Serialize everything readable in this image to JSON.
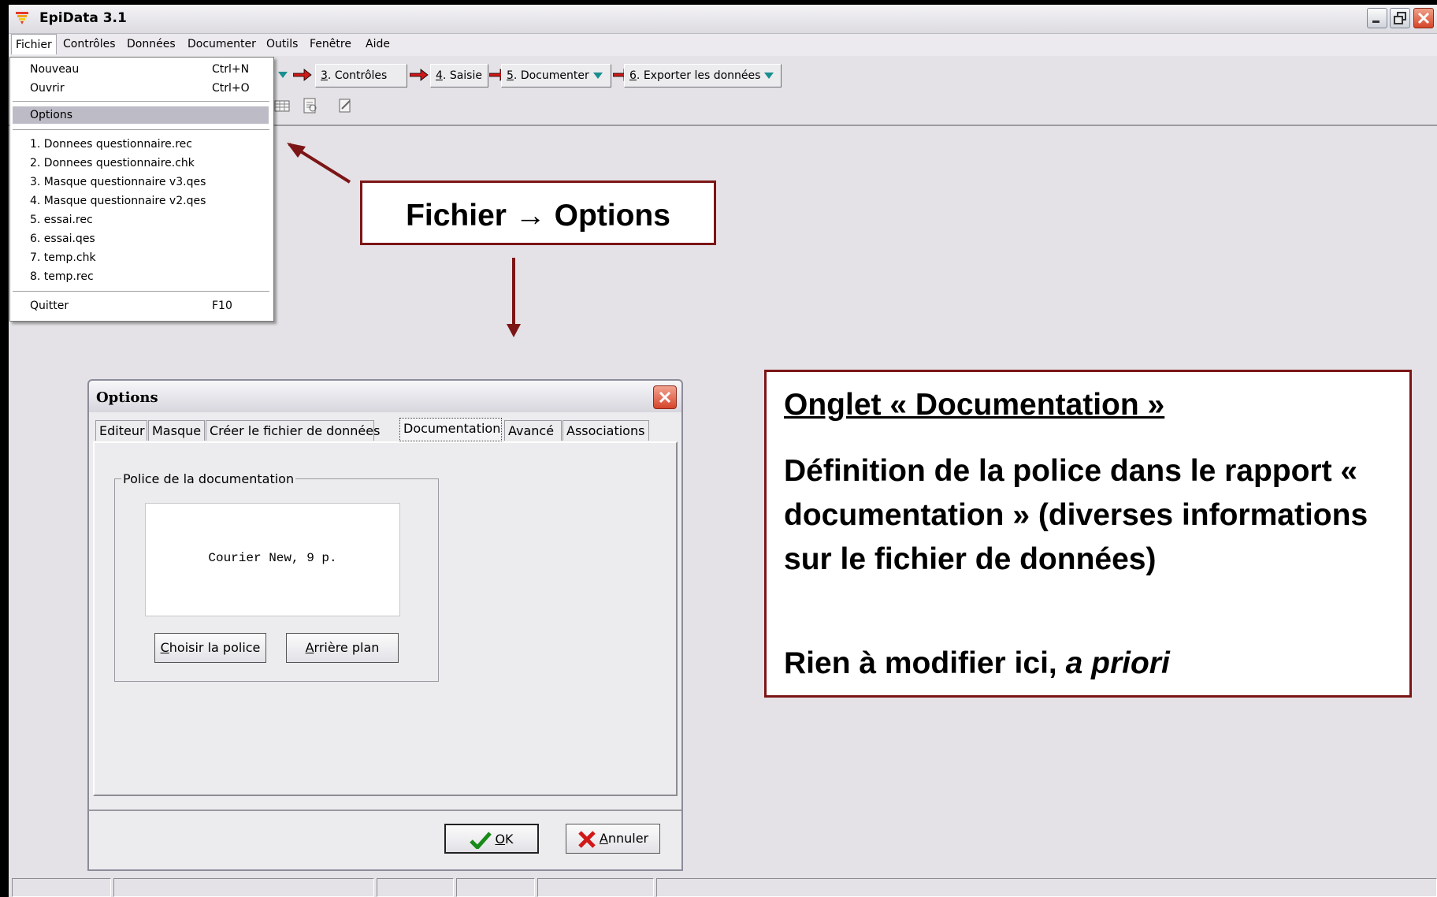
{
  "window": {
    "title": "EpiData 3.1"
  },
  "menubar": [
    "Fichier",
    "Contrôles",
    "Données",
    "Documenter",
    "Outils",
    "Fenêtre",
    "Aide"
  ],
  "toolbar": {
    "step3": {
      "num": "3",
      "label": ". Contrôles"
    },
    "step4": {
      "num": "4",
      "label": ". Saisie"
    },
    "step5": {
      "num": "5",
      "label": ". Documenter"
    },
    "step6": {
      "num": "6",
      "label": ". Exporter les données"
    }
  },
  "file_menu": {
    "new": {
      "label": "Nouveau",
      "shortcut": "Ctrl+N"
    },
    "open": {
      "label": "Ouvrir",
      "shortcut": "Ctrl+O"
    },
    "options": "Options",
    "recent": [
      "1. Donnees questionnaire.rec",
      "2. Donnees questionnaire.chk",
      "3. Masque questionnaire v3.qes",
      "4. Masque questionnaire v2.qes",
      "5. essai.rec",
      "6. essai.qes",
      "7. temp.chk",
      "8. temp.rec"
    ],
    "quit": {
      "label": "Quitter",
      "shortcut": "F10"
    }
  },
  "options_dialog": {
    "title": "Options",
    "tabs": [
      "Editeur",
      "Masque",
      "Créer le fichier de données",
      "Documentation",
      "Avancé",
      "Associations"
    ],
    "active_tab": "Documentation",
    "group_label": "Police de la documentation",
    "font_preview": "Courier New, 9 p.",
    "choose_font_button": {
      "mnemonic": "C",
      "rest": "hoisir la police"
    },
    "background_button": {
      "mnemonic": "A",
      "rest": "rrière plan"
    },
    "ok_button": {
      "mnemonic": "O",
      "rest": "K"
    },
    "cancel_button": {
      "mnemonic": "A",
      "rest": "nnuler"
    }
  },
  "annotation_path": "Fichier → Options",
  "annotation_box": {
    "heading": "Onglet « Documentation »",
    "body": "Définition de la police dans le rapport « documentation » (diverses informations sur le fichier de données)",
    "note_prefix": "Rien à modifier ici, ",
    "note_italic": "a priori"
  },
  "colors": {
    "annotation_border": "#7c1516",
    "arrow": "#7c1516",
    "highlight": "#bdbcc6"
  }
}
